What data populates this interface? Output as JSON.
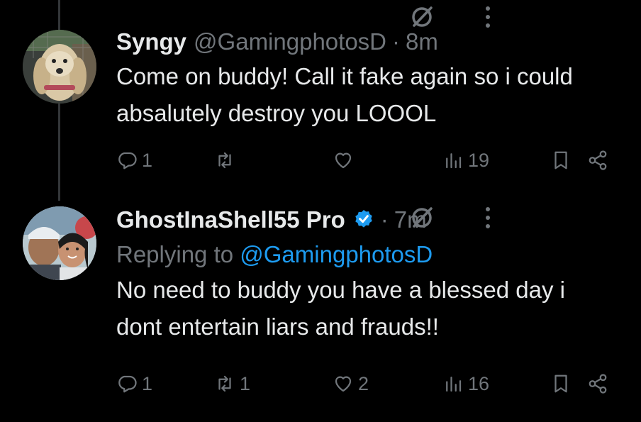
{
  "tweets": [
    {
      "name": "Syngy",
      "handle": "@GamingphotosD",
      "separator": "·",
      "time": "8m",
      "reply_to_prefix": "",
      "reply_to_handle": "",
      "text": "Come on buddy! Call it fake again so i could absalutely destroy you LOOOL",
      "replies": "1",
      "retweets": "",
      "likes": "",
      "views": "19",
      "avatar_icon": "dog-avatar"
    },
    {
      "name": "GhostInaShell55 Pro",
      "handle": "",
      "separator": "·",
      "time": "7m",
      "verified": true,
      "reply_to_prefix": "Replying to ",
      "reply_to_handle": "@GamingphotosD",
      "text": "No need to buddy you have a blessed day i dont entertain liars and frauds!!",
      "replies": "1",
      "retweets": "1",
      "likes": "2",
      "views": "16",
      "avatar_icon": "couple-avatar"
    }
  ],
  "colors": {
    "background": "#000000",
    "text": "#e7e9ea",
    "muted": "#71767b",
    "accent": "#1d9bf0",
    "thread_line": "#333639"
  }
}
